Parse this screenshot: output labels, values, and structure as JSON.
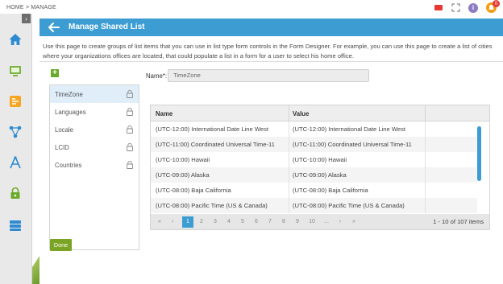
{
  "breadcrumb": "HOME > MANAGE",
  "notifications": {
    "count": "0"
  },
  "header": {
    "title": "Manage Shared List"
  },
  "description": "Use this page to create groups of list items that you can use in list type form controls in the Form Designer. For example, you can use this page to create a list of cities where your organizations offices are located, that could populate a list in a form for a user to select his home office.",
  "lists": [
    {
      "label": "TimeZone",
      "selected": true
    },
    {
      "label": "Languages",
      "selected": false
    },
    {
      "label": "Locale",
      "selected": false
    },
    {
      "label": "LCID",
      "selected": false
    },
    {
      "label": "Countries",
      "selected": false
    }
  ],
  "name_field": {
    "label": "Name*:",
    "value": "TimeZone"
  },
  "grid": {
    "columns": [
      "Name",
      "Value"
    ],
    "rows": [
      [
        "(UTC-12:00) International Date Line West",
        "(UTC-12:00) International Date Line West"
      ],
      [
        "(UTC-11:00) Coordinated Universal Time-11",
        "(UTC-11:00) Coordinated Universal Time-11"
      ],
      [
        "(UTC-10:00) Hawaii",
        "(UTC-10:00) Hawaii"
      ],
      [
        "(UTC-09:00) Alaska",
        "(UTC-09:00) Alaska"
      ],
      [
        "(UTC-08:00) Baja California",
        "(UTC-08:00) Baja California"
      ],
      [
        "(UTC-08:00) Pacific Time (US & Canada)",
        "(UTC-08:00) Pacific Time (US & Canada)"
      ]
    ]
  },
  "pager": {
    "first": "«",
    "prev": "‹",
    "next": "›",
    "last": "»",
    "pages": [
      "1",
      "2",
      "3",
      "4",
      "5",
      "6",
      "7",
      "8",
      "9",
      "10",
      "..."
    ],
    "current_page": "1",
    "info": "1 - 10 of 107 items"
  },
  "done_label": "Done",
  "colors": {
    "accent": "#3d9dd3",
    "done": "#7aa424",
    "add": "#6aaa2a",
    "selected_row": "#dfeef9"
  },
  "icons": {
    "sidebar": [
      "home-icon",
      "monitor-icon",
      "workflow-icon",
      "network-icon",
      "compass-icon",
      "lock-icon",
      "database-icon"
    ],
    "topbar": [
      "flag-icon",
      "fullscreen-icon",
      "info-icon",
      "bell-icon"
    ]
  }
}
